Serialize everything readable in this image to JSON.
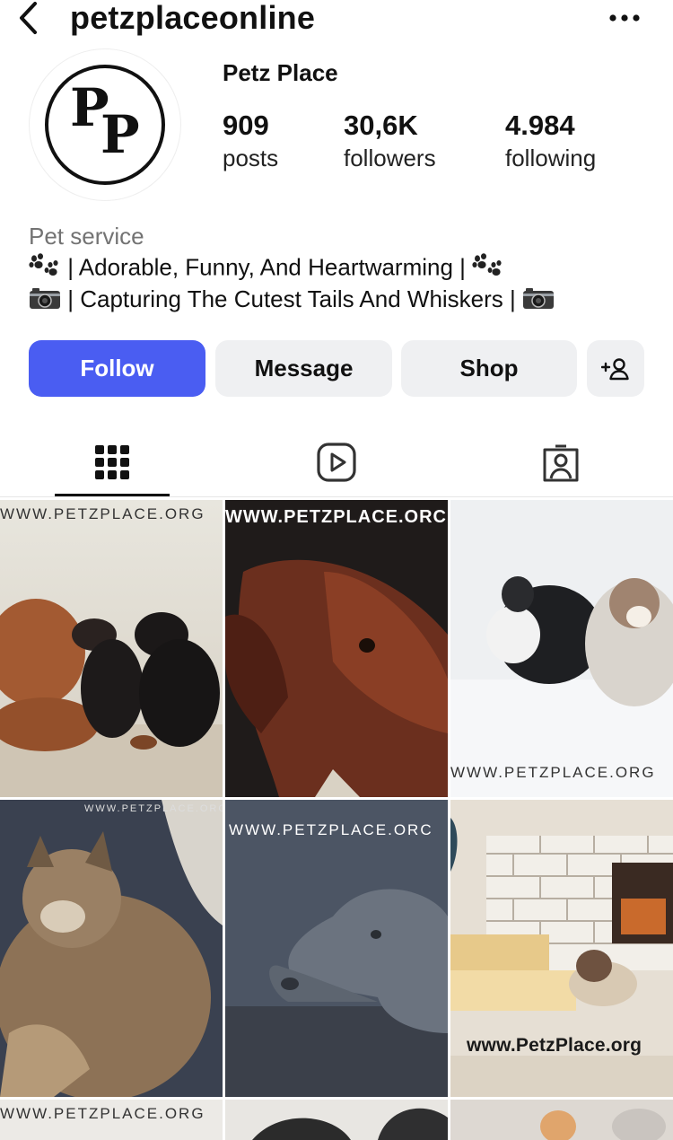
{
  "header": {
    "username": "petzplaceonline",
    "back_icon": "chevron-left-icon",
    "more_icon": "more-horizontal-icon"
  },
  "profile": {
    "display_name": "Petz Place",
    "avatar_logo": "PP",
    "stats": [
      {
        "value": "909",
        "label": "posts"
      },
      {
        "value": "30,6K",
        "label": "followers"
      },
      {
        "value": "4.984",
        "label": "following"
      }
    ],
    "category": "Pet service",
    "bio_line1": " | Adorable, Funny, And Heartwarming | ",
    "bio_line2": " | Capturing The Cutest Tails And Whiskers | "
  },
  "actions": {
    "follow_label": "Follow",
    "message_label": "Message",
    "shop_label": "Shop",
    "add_user_icon": "add-user-icon"
  },
  "tabs": [
    {
      "icon": "grid-icon",
      "selected": true
    },
    {
      "icon": "reels-icon",
      "selected": false
    },
    {
      "icon": "tagged-icon",
      "selected": false
    }
  ],
  "grid": {
    "watermark": "WWW.PETZPLACE.ORG",
    "watermark_clipped": "WWW.PETZPLACE.ORC",
    "watermark_lower": "www.PetzPlace.org",
    "posts": [
      {
        "subject": "mastiff-and-puppies"
      },
      {
        "subject": "brown-dog-closeup"
      },
      {
        "subject": "dog-and-cat-in-snow"
      },
      {
        "subject": "fluffy-cat"
      },
      {
        "subject": "gray-weimaraner"
      },
      {
        "subject": "cat-by-fireplace"
      },
      {
        "subject": "partial-post"
      },
      {
        "subject": "partial-post"
      },
      {
        "subject": "partial-post"
      }
    ]
  },
  "colors": {
    "follow_bg": "#4a5df2",
    "button_bg": "#eff0f2",
    "muted_text": "#737373"
  }
}
